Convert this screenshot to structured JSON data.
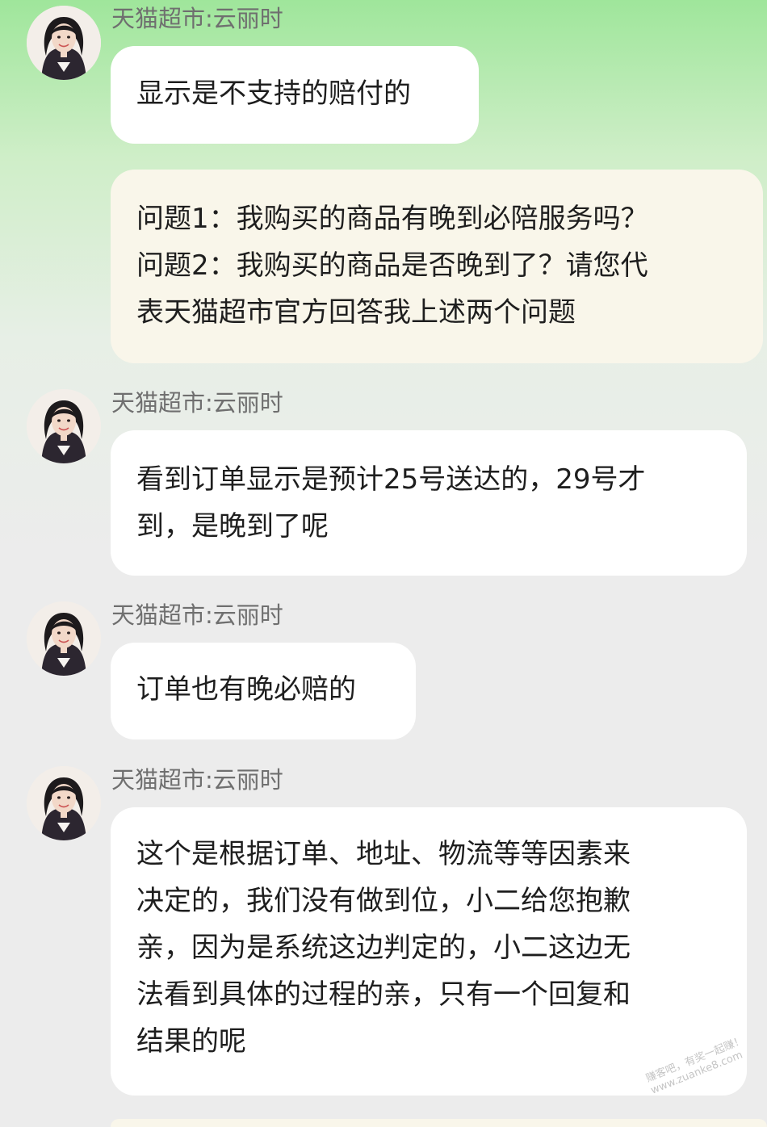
{
  "chat": {
    "messages": [
      {
        "role": "agent",
        "sender": "天猫超市:云丽时",
        "lines": [
          "显示是不支持的赔付的"
        ]
      },
      {
        "role": "user",
        "lines": [
          "问题1：我购买的商品有晚到必陪服务吗？",
          "问题2：我购买的商品是否晚到了？请您代",
          "表天猫超市官方回答我上述两个问题"
        ]
      },
      {
        "role": "agent",
        "sender": "天猫超市:云丽时",
        "lines": [
          "看到订单显示是预计25号送达的，29号才",
          "到，是晚到了呢"
        ]
      },
      {
        "role": "agent",
        "sender": "天猫超市:云丽时",
        "lines": [
          "订单也有晚必赔的"
        ]
      },
      {
        "role": "agent",
        "sender": "天猫超市:云丽时",
        "lines": [
          "这个是根据订单、地址、物流等等因素来",
          "决定的，我们没有做到位，小二给您抱歉",
          "亲，因为是系统这边判定的，小二这边无",
          "法看到具体的过程的亲，只有一个回复和",
          "结果的呢"
        ]
      }
    ]
  },
  "watermark": {
    "line1": "赚客吧，有奖一起赚！",
    "line2": "www.zuanke8.com"
  },
  "colors": {
    "agent_bubble": "#ffffff",
    "user_bubble": "#f9f6ea",
    "sender_text": "#6f6f6f",
    "top_gradient": "#9fe69b"
  },
  "icons": {
    "avatar": "agent-avatar-icon"
  }
}
